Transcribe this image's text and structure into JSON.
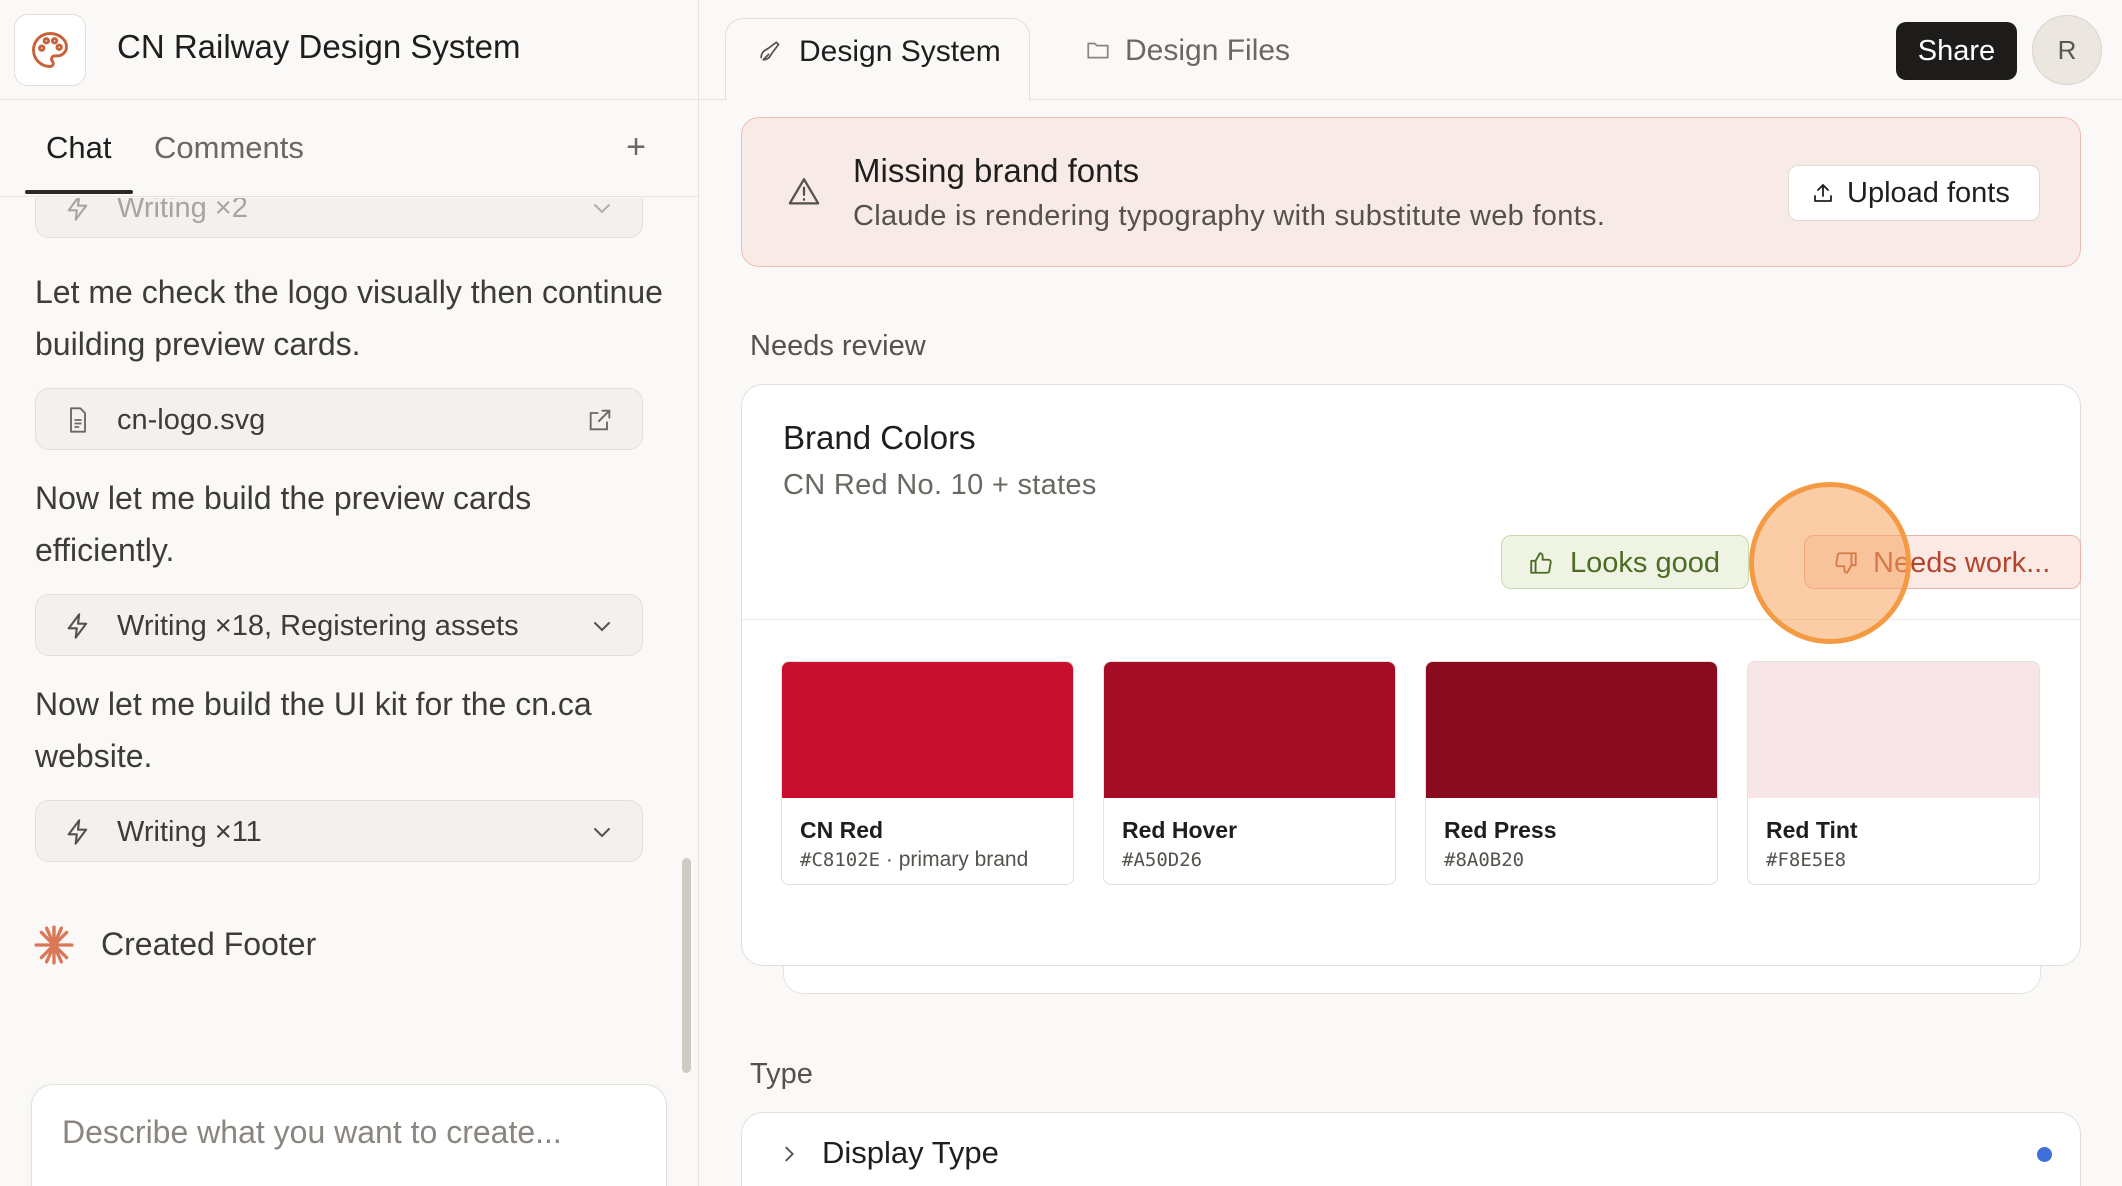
{
  "project": {
    "title": "CN Railway Design System",
    "icon": "palette-icon"
  },
  "left_tabs": [
    {
      "label": "Chat",
      "active": true
    },
    {
      "label": "Comments",
      "active": false
    }
  ],
  "left_tabs_add": "+",
  "chat": {
    "tool_top": {
      "label": "Writing ×2",
      "icon": "lightning-icon"
    },
    "msg1": "Let me check the logo visually then continue building preview cards.",
    "file": {
      "name": "cn-logo.svg",
      "icon": "file-icon",
      "action_icon": "external-link-icon"
    },
    "msg2": "Now let me build the preview cards efficiently.",
    "tool_mid": {
      "label": "Writing ×18, Registering assets",
      "icon": "lightning-icon"
    },
    "msg3": "Now let me build the UI kit for the cn.ca website.",
    "tool_bottom": {
      "label": "Writing ×11",
      "icon": "lightning-icon"
    },
    "status": {
      "label": "Created Footer",
      "icon": "sparkle-icon"
    }
  },
  "composer": {
    "placeholder": "Describe what you want to create...",
    "value": ""
  },
  "topbar": {
    "tabs": [
      {
        "label": "Design System",
        "active": true,
        "icon": "pen-icon"
      },
      {
        "label": "Design Files",
        "active": false,
        "icon": "folder-icon"
      }
    ],
    "share_label": "Share",
    "avatar_initial": "R"
  },
  "alert": {
    "title": "Missing brand fonts",
    "body": "Claude is rendering typography with substitute web fonts.",
    "action_label": "Upload fonts",
    "icon": "warning-icon"
  },
  "sections": {
    "needs_review": "Needs review",
    "type": "Type"
  },
  "brand_card": {
    "title": "Brand Colors",
    "subtitle": "CN Red No. 10 + states",
    "good_label": "Looks good",
    "work_label": "Needs work...",
    "swatches": [
      {
        "name": "CN Red",
        "hex": "#C8102E",
        "note": " · primary brand",
        "color": "#C8102E"
      },
      {
        "name": "Red Hover",
        "hex": "#A50D26",
        "note": "",
        "color": "#A50D26"
      },
      {
        "name": "Red Press",
        "hex": "#8A0B20",
        "note": "",
        "color": "#8A0B20"
      },
      {
        "name": "Red Tint",
        "hex": "#F8E5E8",
        "note": "",
        "color": "#F8E5E8"
      }
    ]
  },
  "type_card": {
    "title": "Display Type",
    "dot_color": "#3f6fd8"
  },
  "colors": {
    "accent": "#d97757",
    "share_bg": "#1d1c1b",
    "alert_bg": "#f8ebe7",
    "highlight": "#f39a43"
  }
}
